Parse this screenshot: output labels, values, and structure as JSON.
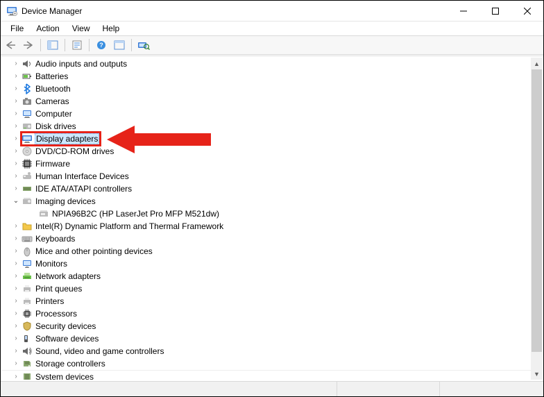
{
  "window": {
    "title": "Device Manager"
  },
  "menu": {
    "file": "File",
    "action": "Action",
    "view": "View",
    "help": "Help"
  },
  "toolbar": {
    "back": "Back",
    "forward": "Forward",
    "show_hide_tree": "Show/Hide Console Tree",
    "properties": "Properties",
    "help": "Help",
    "show_hidden": "Show hidden devices",
    "scan": "Scan for hardware changes"
  },
  "tree": {
    "items": [
      {
        "id": "audio",
        "label": "Audio inputs and outputs",
        "icon": "speaker-icon",
        "expanded": false
      },
      {
        "id": "batteries",
        "label": "Batteries",
        "icon": "battery-icon",
        "expanded": false
      },
      {
        "id": "bluetooth",
        "label": "Bluetooth",
        "icon": "bluetooth-icon",
        "expanded": false
      },
      {
        "id": "cameras",
        "label": "Cameras",
        "icon": "camera-icon",
        "expanded": false
      },
      {
        "id": "computer",
        "label": "Computer",
        "icon": "computer-icon",
        "expanded": false
      },
      {
        "id": "disk",
        "label": "Disk drives",
        "icon": "disk-icon",
        "expanded": false
      },
      {
        "id": "display",
        "label": "Display adapters",
        "icon": "display-icon",
        "expanded": false,
        "selected": true
      },
      {
        "id": "dvd",
        "label": "DVD/CD-ROM drives",
        "icon": "dvd-icon",
        "expanded": false
      },
      {
        "id": "firmware",
        "label": "Firmware",
        "icon": "firmware-icon",
        "expanded": false
      },
      {
        "id": "hid",
        "label": "Human Interface Devices",
        "icon": "hid-icon",
        "expanded": false
      },
      {
        "id": "ide",
        "label": "IDE ATA/ATAPI controllers",
        "icon": "ide-icon",
        "expanded": false
      },
      {
        "id": "imaging",
        "label": "Imaging devices",
        "icon": "imaging-icon",
        "expanded": true,
        "children": [
          {
            "id": "npia",
            "label": "NPIA96B2C (HP LaserJet Pro MFP M521dw)",
            "icon": "scanner-icon"
          }
        ]
      },
      {
        "id": "intel",
        "label": "Intel(R) Dynamic Platform and Thermal Framework",
        "icon": "folder-icon",
        "expanded": false
      },
      {
        "id": "keyboards",
        "label": "Keyboards",
        "icon": "keyboard-icon",
        "expanded": false
      },
      {
        "id": "mice",
        "label": "Mice and other pointing devices",
        "icon": "mouse-icon",
        "expanded": false
      },
      {
        "id": "monitors",
        "label": "Monitors",
        "icon": "monitor-icon",
        "expanded": false
      },
      {
        "id": "network",
        "label": "Network adapters",
        "icon": "network-icon",
        "expanded": false
      },
      {
        "id": "printq",
        "label": "Print queues",
        "icon": "printqueue-icon",
        "expanded": false
      },
      {
        "id": "printers",
        "label": "Printers",
        "icon": "printer-icon",
        "expanded": false
      },
      {
        "id": "processors",
        "label": "Processors",
        "icon": "cpu-icon",
        "expanded": false
      },
      {
        "id": "security",
        "label": "Security devices",
        "icon": "security-icon",
        "expanded": false
      },
      {
        "id": "software",
        "label": "Software devices",
        "icon": "software-icon",
        "expanded": false
      },
      {
        "id": "sound",
        "label": "Sound, video and game controllers",
        "icon": "sound-icon",
        "expanded": false
      },
      {
        "id": "storage",
        "label": "Storage controllers",
        "icon": "storage-icon",
        "expanded": false
      },
      {
        "id": "system",
        "label": "System devices",
        "icon": "system-icon",
        "expanded": false,
        "cut": true
      }
    ]
  },
  "annotation": {
    "highlight_target_id": "display"
  }
}
